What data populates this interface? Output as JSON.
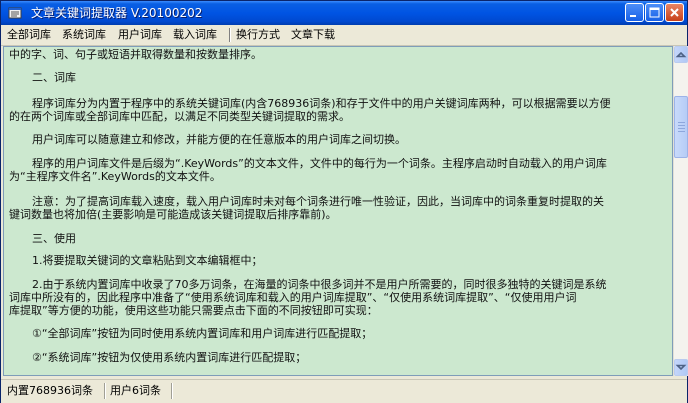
{
  "window": {
    "title": "文章关键词提取器 V.20100202"
  },
  "menu": [
    {
      "label": "全部词库"
    },
    {
      "label": "系统词库"
    },
    {
      "label": "用户词库"
    },
    {
      "label": "载入词库"
    },
    {
      "label": "换行方式"
    },
    {
      "label": "文章下载"
    }
  ],
  "content": {
    "lines": [
      "中的字、词、句子或短语并取得数量和按数量排序。",
      "二、词库",
      "程序词库分为内置于程序中的系统关键词库(内含768936词条)和存于文件中的用户关键词库两种，可以根据需要以方便",
      "的在两个词库或全部词库中匹配，以满足不同类型关键词提取的需求。",
      "用户词库可以随意建立和修改，并能方便的在任意版本的用户词库之间切换。",
      "程序的用户词库文件是后缀为“.KeyWords”的文本文件，文件中的每行为一个词条。主程序启动时自动载入的用户词库",
      "为“主程序文件名”.KeyWords的文本文件。",
      "注意：为了提高词库载入速度，载入用户词库时未对每个词条进行唯一性验证，因此，当词库中的词条重复时提取的关",
      "键词数量也将加倍(主要影响是可能造成该关键词提取后排序靠前)。",
      "三、使用",
      "1.将要提取关键词的文章粘贴到文本编辑框中；",
      "2.由于系统内置词库中收录了70多万词条，在海量的词条中很多词并不是用户所需要的，同时很多独特的关键词是系统",
      "词库中所没有的，因此程序中准备了“使用系统词库和载入的用户词库提取”、“仅使用系统词库提取”、“仅使用用户词",
      "库提取”等方便的功能，使用这些功能只需要点击下面的不同按钮即可实现：",
      "①“全部词库”按钮为同时使用系统内置词库和用户词库进行匹配提取；",
      "②“系统词库”按钮为仅使用系统内置词库进行匹配提取；"
    ]
  },
  "status": {
    "builtin": "内置768936词条",
    "user": "用户6词条"
  }
}
